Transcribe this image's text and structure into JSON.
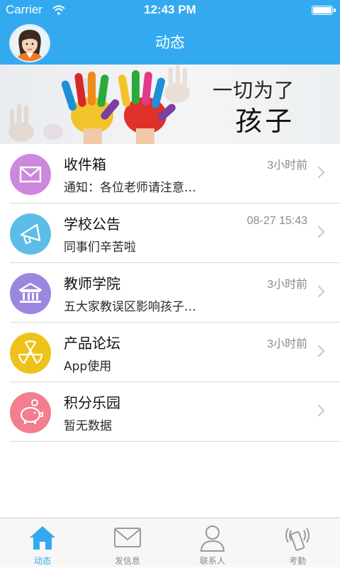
{
  "status_bar": {
    "carrier": "Carrier",
    "time": "12:43 PM"
  },
  "nav": {
    "title": "动态"
  },
  "banner": {
    "line1": "一切为了",
    "line2": "孩子"
  },
  "list": [
    {
      "title": "收件箱",
      "subtitle": "通知：各位老师请注意…",
      "time": "3小时前",
      "icon": "mail-icon",
      "color": "#cc88dc"
    },
    {
      "title": "学校公告",
      "subtitle": "同事们辛苦啦",
      "time": "08-27 15:43",
      "icon": "megaphone-icon",
      "color": "#5bbde8"
    },
    {
      "title": "教师学院",
      "subtitle": "五大家教误区影响孩子…",
      "time": "3小时前",
      "icon": "academy-icon",
      "color": "#9b86e0"
    },
    {
      "title": "产品论坛",
      "subtitle": "App使用",
      "time": "3小时前",
      "icon": "forum-icon",
      "color": "#eec21a"
    },
    {
      "title": "积分乐园",
      "subtitle": "暂无数据",
      "time": "",
      "icon": "piggy-bank-icon",
      "color": "#f27e8e"
    }
  ],
  "tabs": [
    {
      "label": "动态",
      "icon": "home-icon",
      "active": true
    },
    {
      "label": "发信息",
      "icon": "message-icon",
      "active": false
    },
    {
      "label": "联系人",
      "icon": "contacts-icon",
      "active": false
    },
    {
      "label": "考勤",
      "icon": "attendance-icon",
      "active": false
    }
  ],
  "colors": {
    "accent": "#33aaf0",
    "tab_inactive": "#8a8a8a"
  }
}
